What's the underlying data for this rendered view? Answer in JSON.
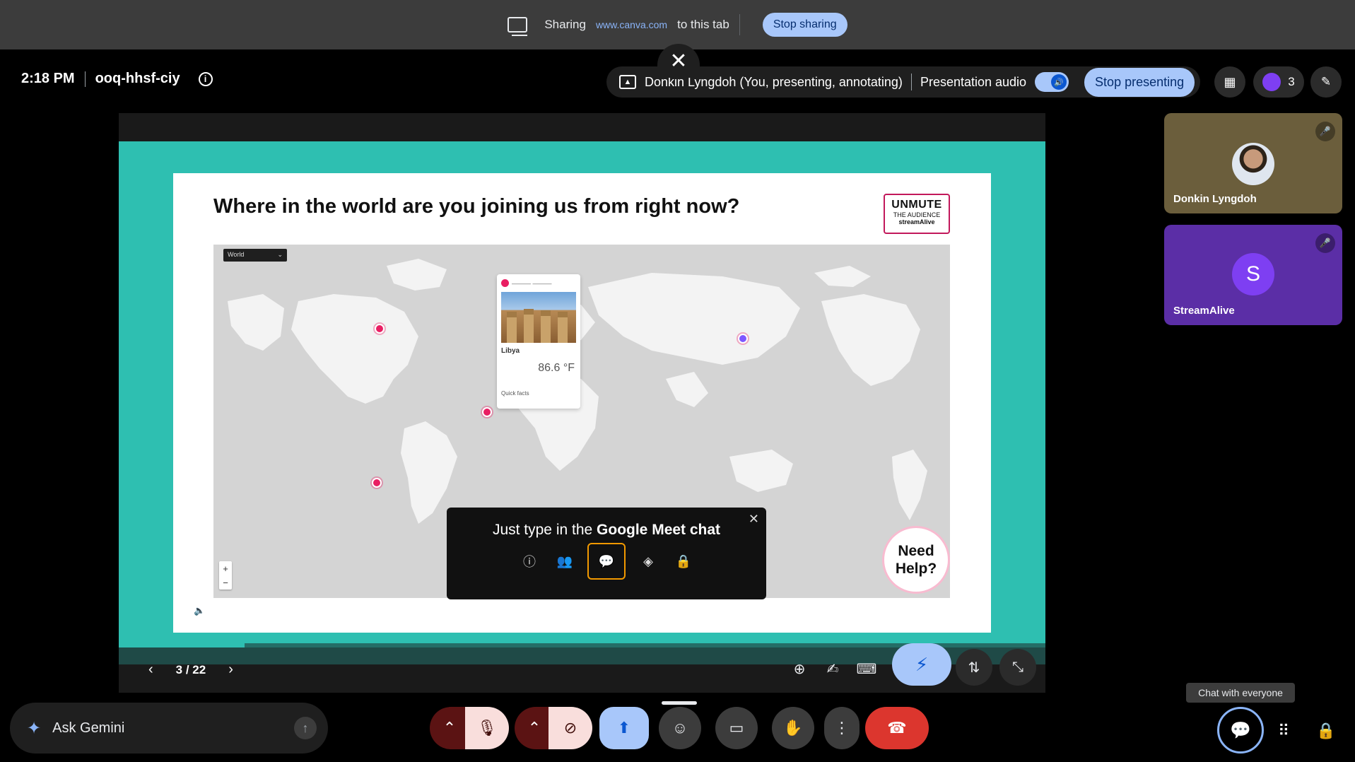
{
  "share_bar": {
    "label": "Sharing",
    "site": "www.canva.com",
    "suffix": "to this tab",
    "stop_label": "Stop sharing"
  },
  "header": {
    "time": "2:18 PM",
    "meeting_code": "ooq-hhsf-ciy"
  },
  "present_pill": {
    "presenter_text": "Donkin Lyngdoh (You, presenting, annotating)",
    "audio_label": "Presentation audio",
    "stop_label": "Stop presenting",
    "participant_count": "3"
  },
  "slide": {
    "title": "Where in the world are you joining us from right now?",
    "logo_line1": "UNMUTE",
    "logo_line2": "THE AUDIENCE",
    "logo_line3": "streamAlive",
    "map_select": "World",
    "popup_country": "Libya",
    "popup_temp": "86.6 °F",
    "popup_quick": "Quick facts",
    "tip_prefix": "Just type in the ",
    "tip_bold": "Google Meet chat",
    "need_help": "Need Help?"
  },
  "slide_nav": {
    "counter": "3 / 22"
  },
  "progress": {
    "fraction": 0.136
  },
  "tiles": [
    {
      "name": "Donkin Lyngdoh"
    },
    {
      "name": "StreamAlive",
      "initial": "S"
    }
  ],
  "bottom": {
    "gemini_label": "Ask Gemini",
    "chat_tooltip": "Chat with everyone"
  },
  "colors": {
    "slide_teal": "#2ebfb1",
    "accent_blue": "#a8c7fa",
    "end_call_red": "#dc362e",
    "pin_pink": "#e91e63",
    "pin_purple": "#7e57ff"
  }
}
